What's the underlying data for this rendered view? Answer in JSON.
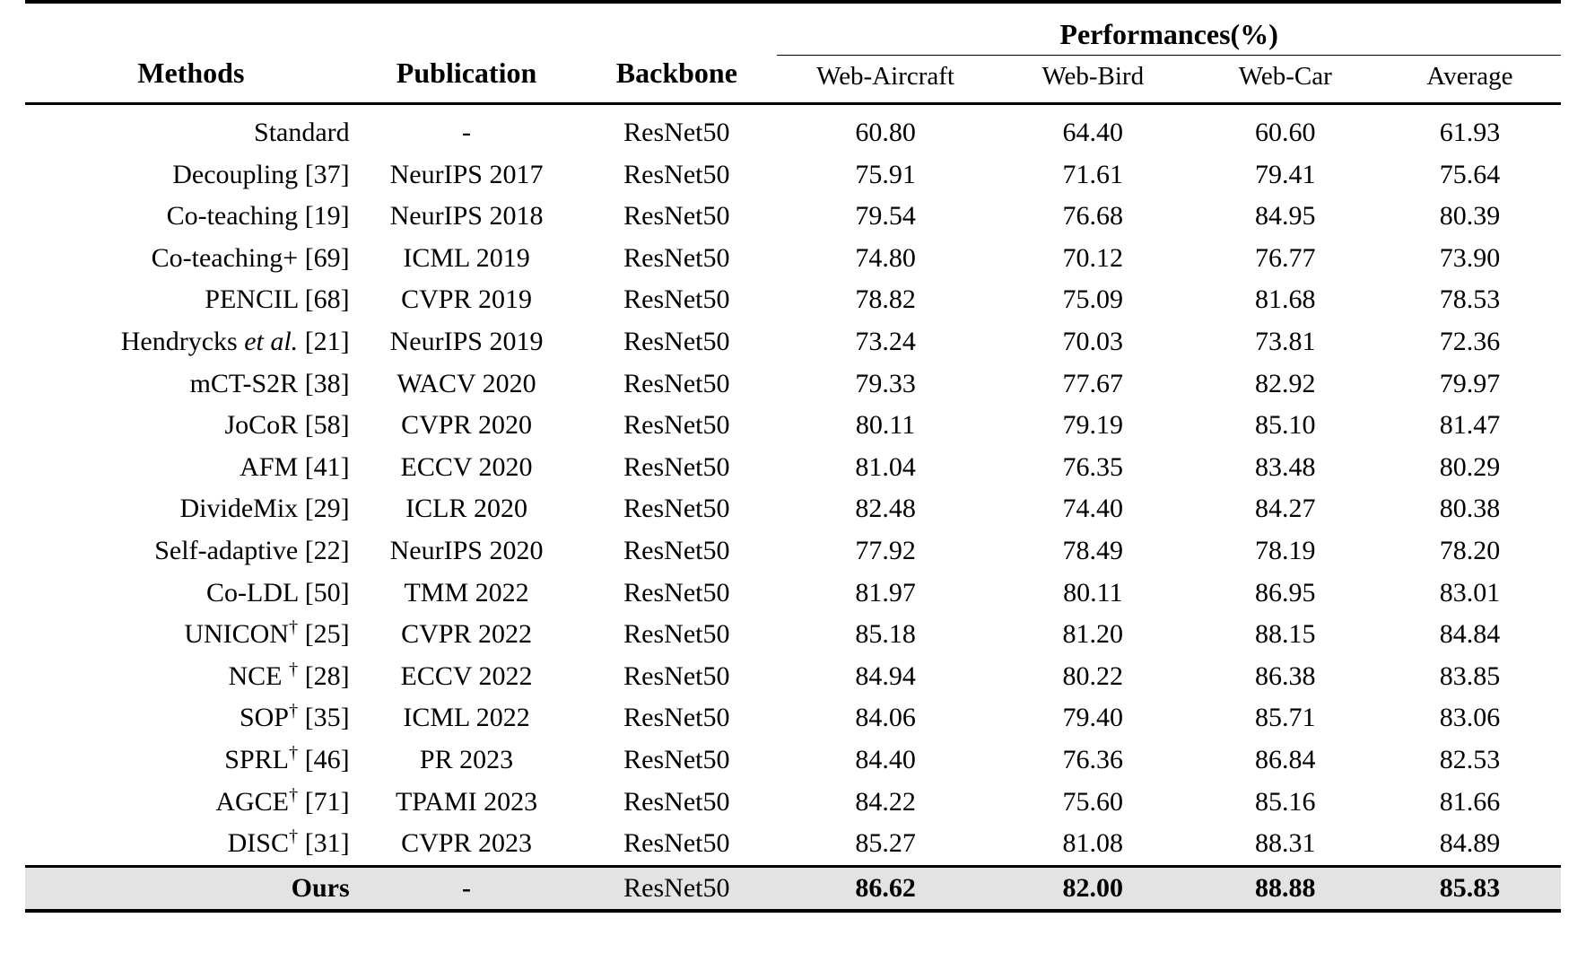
{
  "table": {
    "group_header": "Performances(%)",
    "columns": {
      "methods": "Methods",
      "publication": "Publication",
      "backbone": "Backbone",
      "web_aircraft": "Web-Aircraft",
      "web_bird": "Web-Bird",
      "web_car": "Web-Car",
      "average": "Average"
    },
    "highlight_color": "#e3e3e3",
    "rows": [
      {
        "method": "Standard",
        "dagger": false,
        "ref": "",
        "publication": "-",
        "backbone": "ResNet50",
        "web_aircraft": "60.80",
        "web_bird": "64.40",
        "web_car": "60.60",
        "average": "61.93",
        "highlight": false,
        "bold": false
      },
      {
        "method": "Decoupling",
        "dagger": false,
        "ref": "[37]",
        "publication": "NeurIPS 2017",
        "backbone": "ResNet50",
        "web_aircraft": "75.91",
        "web_bird": "71.61",
        "web_car": "79.41",
        "average": "75.64",
        "highlight": false,
        "bold": false
      },
      {
        "method": "Co-teaching",
        "dagger": false,
        "ref": "[19]",
        "publication": "NeurIPS 2018",
        "backbone": "ResNet50",
        "web_aircraft": "79.54",
        "web_bird": "76.68",
        "web_car": "84.95",
        "average": "80.39",
        "highlight": false,
        "bold": false
      },
      {
        "method": "Co-teaching+",
        "dagger": false,
        "ref": "[69]",
        "publication": "ICML 2019",
        "backbone": "ResNet50",
        "web_aircraft": "74.80",
        "web_bird": "70.12",
        "web_car": "76.77",
        "average": "73.90",
        "highlight": false,
        "bold": false
      },
      {
        "method": "PENCIL",
        "dagger": false,
        "ref": "[68]",
        "publication": "CVPR 2019",
        "backbone": "ResNet50",
        "web_aircraft": "78.82",
        "web_bird": "75.09",
        "web_car": "81.68",
        "average": "78.53",
        "highlight": false,
        "bold": false
      },
      {
        "method": "Hendrycks et al.",
        "italic_part": "et al.",
        "dagger": false,
        "ref": "[21]",
        "publication": "NeurIPS 2019",
        "backbone": "ResNet50",
        "web_aircraft": "73.24",
        "web_bird": "70.03",
        "web_car": "73.81",
        "average": "72.36",
        "highlight": false,
        "bold": false
      },
      {
        "method": "mCT-S2R",
        "dagger": false,
        "ref": "[38]",
        "publication": "WACV 2020",
        "backbone": "ResNet50",
        "web_aircraft": "79.33",
        "web_bird": "77.67",
        "web_car": "82.92",
        "average": "79.97",
        "highlight": false,
        "bold": false
      },
      {
        "method": "JoCoR",
        "dagger": false,
        "ref": "[58]",
        "publication": "CVPR 2020",
        "backbone": "ResNet50",
        "web_aircraft": "80.11",
        "web_bird": "79.19",
        "web_car": "85.10",
        "average": "81.47",
        "highlight": false,
        "bold": false
      },
      {
        "method": "AFM",
        "dagger": false,
        "ref": "[41]",
        "publication": "ECCV 2020",
        "backbone": "ResNet50",
        "web_aircraft": "81.04",
        "web_bird": "76.35",
        "web_car": "83.48",
        "average": "80.29",
        "highlight": false,
        "bold": false
      },
      {
        "method": "DivideMix",
        "dagger": false,
        "ref": "[29]",
        "publication": "ICLR 2020",
        "backbone": "ResNet50",
        "web_aircraft": "82.48",
        "web_bird": "74.40",
        "web_car": "84.27",
        "average": "80.38",
        "highlight": false,
        "bold": false
      },
      {
        "method": "Self-adaptive",
        "dagger": false,
        "ref": "[22]",
        "publication": "NeurIPS 2020",
        "backbone": "ResNet50",
        "web_aircraft": "77.92",
        "web_bird": "78.49",
        "web_car": "78.19",
        "average": "78.20",
        "highlight": false,
        "bold": false
      },
      {
        "method": "Co-LDL",
        "dagger": false,
        "ref": "[50]",
        "publication": "TMM 2022",
        "backbone": "ResNet50",
        "web_aircraft": "81.97",
        "web_bird": "80.11",
        "web_car": "86.95",
        "average": "83.01",
        "highlight": false,
        "bold": false
      },
      {
        "method": "UNICON",
        "dagger": true,
        "ref": "[25]",
        "publication": "CVPR 2022",
        "backbone": "ResNet50",
        "web_aircraft": "85.18",
        "web_bird": "81.20",
        "web_car": "88.15",
        "average": "84.84",
        "highlight": false,
        "bold": false
      },
      {
        "method": "NCE ",
        "dagger": true,
        "ref": "[28]",
        "publication": "ECCV 2022",
        "backbone": "ResNet50",
        "web_aircraft": "84.94",
        "web_bird": "80.22",
        "web_car": "86.38",
        "average": "83.85",
        "highlight": false,
        "bold": false
      },
      {
        "method": "SOP",
        "dagger": true,
        "ref": "[35]",
        "publication": "ICML 2022",
        "backbone": "ResNet50",
        "web_aircraft": "84.06",
        "web_bird": "79.40",
        "web_car": "85.71",
        "average": "83.06",
        "highlight": false,
        "bold": false
      },
      {
        "method": "SPRL",
        "dagger": true,
        "ref": "[46]",
        "publication": "PR 2023",
        "backbone": "ResNet50",
        "web_aircraft": "84.40",
        "web_bird": "76.36",
        "web_car": "86.84",
        "average": "82.53",
        "highlight": false,
        "bold": false
      },
      {
        "method": "AGCE",
        "dagger": true,
        "ref": "[71]",
        "publication": "TPAMI 2023",
        "backbone": "ResNet50",
        "web_aircraft": "84.22",
        "web_bird": "75.60",
        "web_car": "85.16",
        "average": "81.66",
        "highlight": false,
        "bold": false
      },
      {
        "method": "DISC",
        "dagger": true,
        "ref": "[31]",
        "publication": "CVPR 2023",
        "backbone": "ResNet50",
        "web_aircraft": "85.27",
        "web_bird": "81.08",
        "web_car": "88.31",
        "average": "84.89",
        "highlight": false,
        "bold": false
      },
      {
        "method": "Ours",
        "dagger": false,
        "ref": "",
        "publication": "-",
        "backbone": "ResNet50",
        "web_aircraft": "86.62",
        "web_bird": "82.00",
        "web_car": "88.88",
        "average": "85.83",
        "highlight": true,
        "bold": true
      }
    ]
  }
}
